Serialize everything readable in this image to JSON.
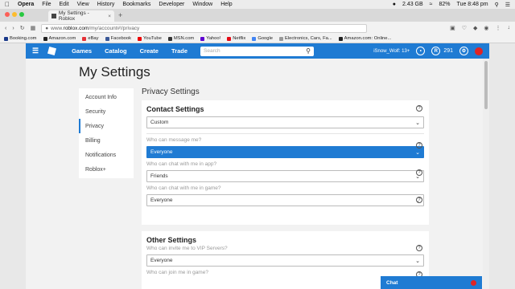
{
  "macbar": {
    "app": "Opera",
    "menus": [
      "File",
      "Edit",
      "View",
      "History",
      "Bookmarks",
      "Developer",
      "Window",
      "Help"
    ],
    "memory": "2.43 GB",
    "battery": "82%",
    "clock": "Tue 8:48 pm"
  },
  "tab": {
    "title": "My Settings - Roblox"
  },
  "address": {
    "url_dim": "www.",
    "url_domain": "roblox.com",
    "url_path": "/my/account#!/privacy"
  },
  "bookmarks": [
    {
      "label": "Booking.com",
      "color": "#1a3a8a"
    },
    {
      "label": "Amazon.com",
      "color": "#222"
    },
    {
      "label": "eBay",
      "color": "#e53238"
    },
    {
      "label": "Facebook",
      "color": "#3b5998"
    },
    {
      "label": "YouTube",
      "color": "#e00"
    },
    {
      "label": "MSN.com",
      "color": "#333"
    },
    {
      "label": "Yahoo!",
      "color": "#5f01d1"
    },
    {
      "label": "Netflix",
      "color": "#e50914"
    },
    {
      "label": "Google",
      "color": "#4285f4"
    },
    {
      "label": "Electronics, Cars, Fa...",
      "color": "#999"
    },
    {
      "label": "Amazon.com: Online...",
      "color": "#222"
    }
  ],
  "nav": {
    "links": [
      "Games",
      "Catalog",
      "Create",
      "Trade"
    ],
    "search_placeholder": "Search",
    "username": "iSnow_Wolf: 13+",
    "robux": "291"
  },
  "page": {
    "title": "My Settings",
    "section_title": "Privacy Settings",
    "side_items": [
      "Account Info",
      "Security",
      "Privacy",
      "Billing",
      "Notifications",
      "Roblox+"
    ],
    "active_side": "Privacy"
  },
  "contact": {
    "heading": "Contact Settings",
    "preset": "Custom",
    "fields": [
      {
        "label": "Who can message me?",
        "value": "Everyone"
      },
      {
        "label": "Who can chat with me in app?",
        "value": "Friends"
      },
      {
        "label": "Who can chat with me in game?",
        "value": "Everyone"
      }
    ]
  },
  "other": {
    "heading": "Other Settings",
    "fields": [
      {
        "label": "Who can invite me to VIP Servers?",
        "value": "Everyone"
      },
      {
        "label": "Who can join me in game?",
        "value": ""
      }
    ]
  },
  "chat": {
    "label": "Chat"
  },
  "colors": {
    "accent": "#1f7bd3",
    "alert": "#e02424"
  }
}
